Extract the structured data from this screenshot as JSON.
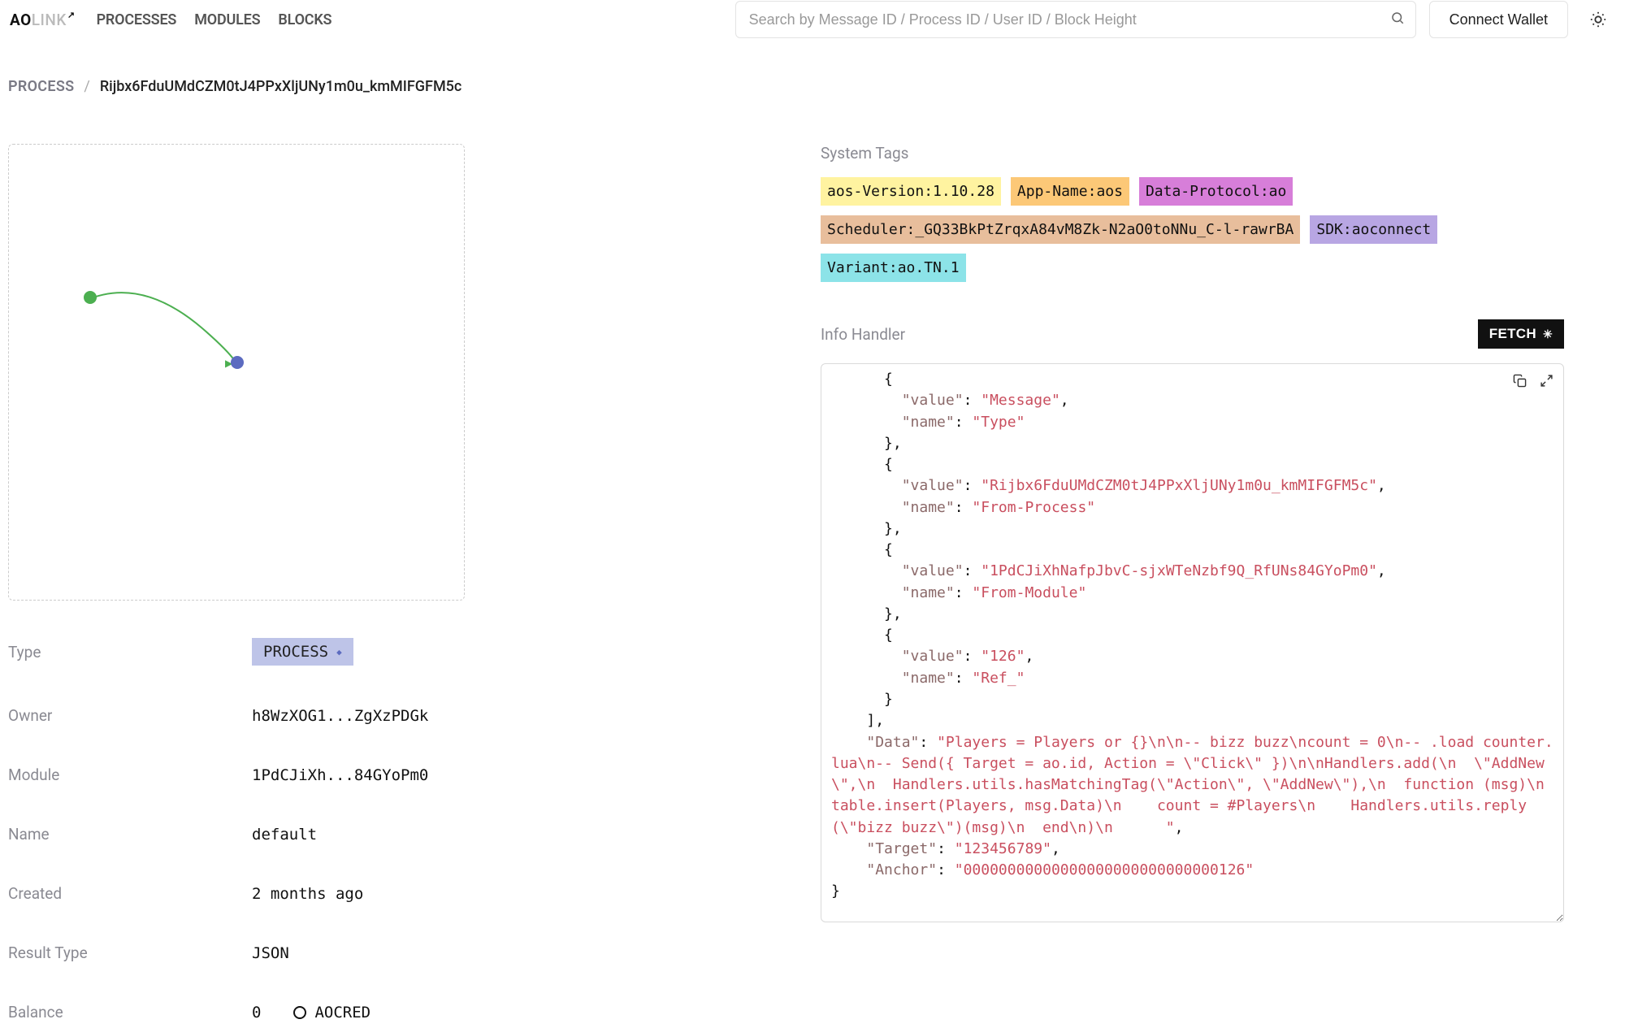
{
  "logo": {
    "ao": "AO",
    "link": "LINK",
    "up": "↗"
  },
  "nav": {
    "processes": "PROCESSES",
    "modules": "MODULES",
    "blocks": "BLOCKS"
  },
  "search": {
    "placeholder": "Search by Message ID / Process ID / User ID / Block Height"
  },
  "wallet": {
    "label": "Connect Wallet"
  },
  "breadcrumb": {
    "process": "PROCESS",
    "sep": "/",
    "id": "Rijbx6FduUMdCZM0tJ4PPxXljUNy1m0u_kmMIFGFM5c"
  },
  "details": {
    "type_label": "Type",
    "type_value": "PROCESS",
    "owner_label": "Owner",
    "owner_value": "h8WzXOG1...ZgXzPDGk",
    "module_label": "Module",
    "module_value": "1PdCJiXh...84GYoPm0",
    "name_label": "Name",
    "name_value": "default",
    "created_label": "Created",
    "created_value": "2 months ago",
    "result_type_label": "Result Type",
    "result_type_value": "JSON",
    "balance_label": "Balance",
    "balance_value": "0",
    "balance_token": "AOCRED"
  },
  "system_tags": {
    "title": "System Tags",
    "items": [
      {
        "text": "aos-Version:1.10.28",
        "color": "yellow"
      },
      {
        "text": "App-Name:aos",
        "color": "orange"
      },
      {
        "text": "Data-Protocol:ao",
        "color": "magenta"
      },
      {
        "text": "Scheduler:_GQ33BkPtZrqxA84vM8Zk-N2aO0toNNu_C-l-rawrBA",
        "color": "tan"
      },
      {
        "text": "SDK:aoconnect",
        "color": "purple"
      },
      {
        "text": "Variant:ao.TN.1",
        "color": "cyan"
      }
    ]
  },
  "info_handler": {
    "title": "Info Handler",
    "fetch": "FETCH",
    "code_parts": [
      {
        "t": "p",
        "v": "      {\n        "
      },
      {
        "t": "k",
        "v": "\"value\""
      },
      {
        "t": "p",
        "v": ": "
      },
      {
        "t": "s",
        "v": "\"Message\""
      },
      {
        "t": "p",
        "v": ",\n        "
      },
      {
        "t": "k",
        "v": "\"name\""
      },
      {
        "t": "p",
        "v": ": "
      },
      {
        "t": "s",
        "v": "\"Type\""
      },
      {
        "t": "p",
        "v": "\n      },\n      {\n        "
      },
      {
        "t": "k",
        "v": "\"value\""
      },
      {
        "t": "p",
        "v": ": "
      },
      {
        "t": "s",
        "v": "\"Rijbx6FduUMdCZM0tJ4PPxXljUNy1m0u_kmMIFGFM5c\""
      },
      {
        "t": "p",
        "v": ",\n        "
      },
      {
        "t": "k",
        "v": "\"name\""
      },
      {
        "t": "p",
        "v": ": "
      },
      {
        "t": "s",
        "v": "\"From-Process\""
      },
      {
        "t": "p",
        "v": "\n      },\n      {\n        "
      },
      {
        "t": "k",
        "v": "\"value\""
      },
      {
        "t": "p",
        "v": ": "
      },
      {
        "t": "s",
        "v": "\"1PdCJiXhNafpJbvC-sjxWTeNzbf9Q_RfUNs84GYoPm0\""
      },
      {
        "t": "p",
        "v": ",\n        "
      },
      {
        "t": "k",
        "v": "\"name\""
      },
      {
        "t": "p",
        "v": ": "
      },
      {
        "t": "s",
        "v": "\"From-Module\""
      },
      {
        "t": "p",
        "v": "\n      },\n      {\n        "
      },
      {
        "t": "k",
        "v": "\"value\""
      },
      {
        "t": "p",
        "v": ": "
      },
      {
        "t": "s",
        "v": "\"126\""
      },
      {
        "t": "p",
        "v": ",\n        "
      },
      {
        "t": "k",
        "v": "\"name\""
      },
      {
        "t": "p",
        "v": ": "
      },
      {
        "t": "s",
        "v": "\"Ref_\""
      },
      {
        "t": "p",
        "v": "\n      }\n    ],\n    "
      },
      {
        "t": "k",
        "v": "\"Data\""
      },
      {
        "t": "p",
        "v": ": "
      },
      {
        "t": "s",
        "v": "\"Players = Players or {}\\n\\n-- bizz buzz\\ncount = 0\\n-- .load counter.lua\\n-- Send({ Target = ao.id, Action = \\\"Click\\\" })\\n\\nHandlers.add(\\n  \\\"AddNew\\\",\\n  Handlers.utils.hasMatchingTag(\\\"Action\\\", \\\"AddNew\\\"),\\n  function (msg)\\n    table.insert(Players, msg.Data)\\n    count = #Players\\n    Handlers.utils.reply(\\\"bizz buzz\\\")(msg)\\n  end\\n)\\n      \""
      },
      {
        "t": "p",
        "v": ",\n    "
      },
      {
        "t": "k",
        "v": "\"Target\""
      },
      {
        "t": "p",
        "v": ": "
      },
      {
        "t": "s",
        "v": "\"123456789\""
      },
      {
        "t": "p",
        "v": ",\n    "
      },
      {
        "t": "k",
        "v": "\"Anchor\""
      },
      {
        "t": "p",
        "v": ": "
      },
      {
        "t": "s",
        "v": "\"00000000000000000000000000000126\""
      },
      {
        "t": "p",
        "v": "\n}"
      }
    ]
  }
}
